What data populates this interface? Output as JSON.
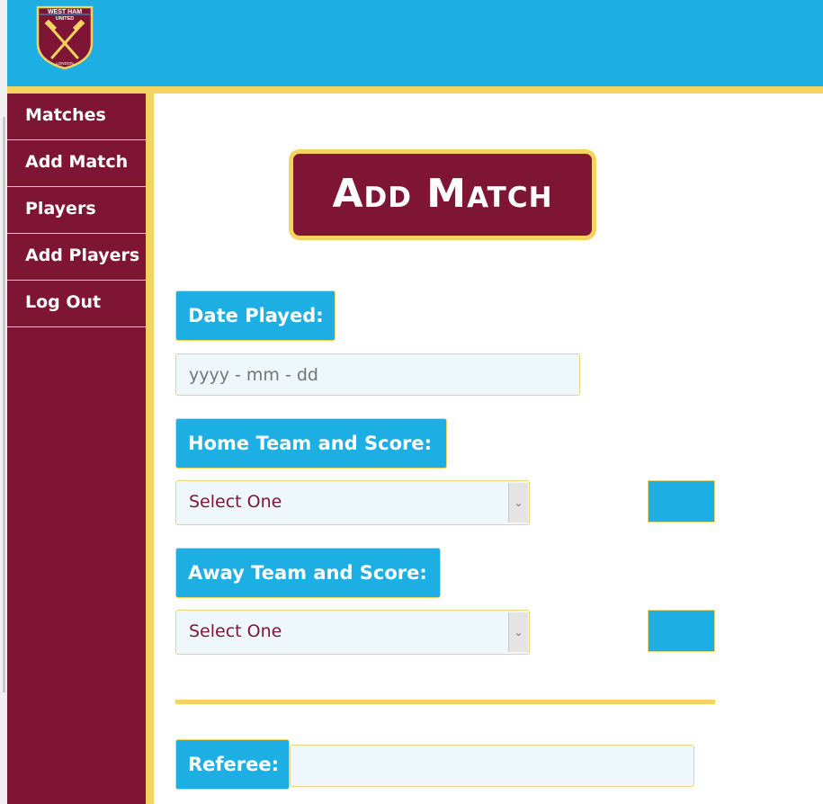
{
  "brand": {
    "crest_text_top": "WEST HAM",
    "crest_text_mid": "UNITED",
    "crest_text_bottom": "LONDON",
    "colors": {
      "sky_blue": "#1daee3",
      "claret": "#7e1535",
      "gold": "#f4d35e"
    }
  },
  "sidebar": {
    "items": [
      {
        "label": "Matches"
      },
      {
        "label": "Add Match"
      },
      {
        "label": "Players"
      },
      {
        "label": "Add Players"
      },
      {
        "label": "Log Out"
      }
    ]
  },
  "page": {
    "title": "Add Match"
  },
  "form": {
    "date_label": "Date Played:",
    "date_placeholder": "yyyy - mm - dd",
    "home_label": "Home Team and Score:",
    "home_select_value": "Select One",
    "home_score_value": "",
    "away_label": "Away Team and Score:",
    "away_select_value": "Select One",
    "away_score_value": "",
    "referee_label": "Referee:",
    "referee_value": ""
  },
  "icons": {
    "select_arrow": "chevron-down-icon",
    "crest": "club-crest-icon"
  }
}
